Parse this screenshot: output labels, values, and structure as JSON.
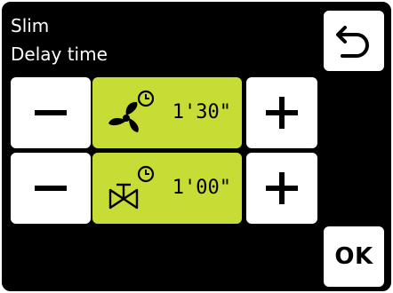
{
  "header": {
    "title_line1": "Slim",
    "title_line2": "Delay time"
  },
  "rows": [
    {
      "icon": "fan-timer-icon",
      "value": "1'30\""
    },
    {
      "icon": "valve-timer-icon",
      "value": "1'00\""
    }
  ],
  "footer": {
    "ok_label": "OK"
  },
  "colors": {
    "background": "#000000",
    "frame": "#ffffff",
    "accent": "#c8dc36",
    "button": "#ffffff",
    "text": "#ffffff"
  }
}
